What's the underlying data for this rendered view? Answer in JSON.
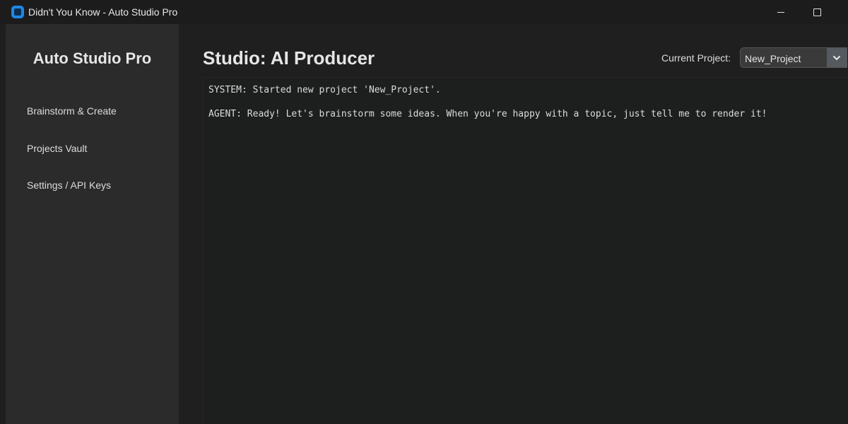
{
  "window": {
    "title": "Didn't You Know - Auto Studio Pro",
    "controls": [
      "minimize-icon",
      "maximize-icon"
    ]
  },
  "sidebar": {
    "title": "Auto Studio Pro",
    "items": [
      {
        "label": "Brainstorm & Create"
      },
      {
        "label": "Projects Vault"
      },
      {
        "label": "Settings / API Keys"
      }
    ]
  },
  "main": {
    "title": "Studio: AI Producer",
    "project_label": "Current Project:",
    "project_value": "New_Project",
    "log": [
      "SYSTEM: Started new project 'New_Project'.",
      "AGENT: Ready! Let's brainstorm some ideas. When you're happy with a topic, just tell me to render it!"
    ]
  },
  "colors": {
    "app_icon": "#1e88e5",
    "sidebar_bg": "#2b2b2b",
    "log_bg": "#1d1e1e"
  }
}
